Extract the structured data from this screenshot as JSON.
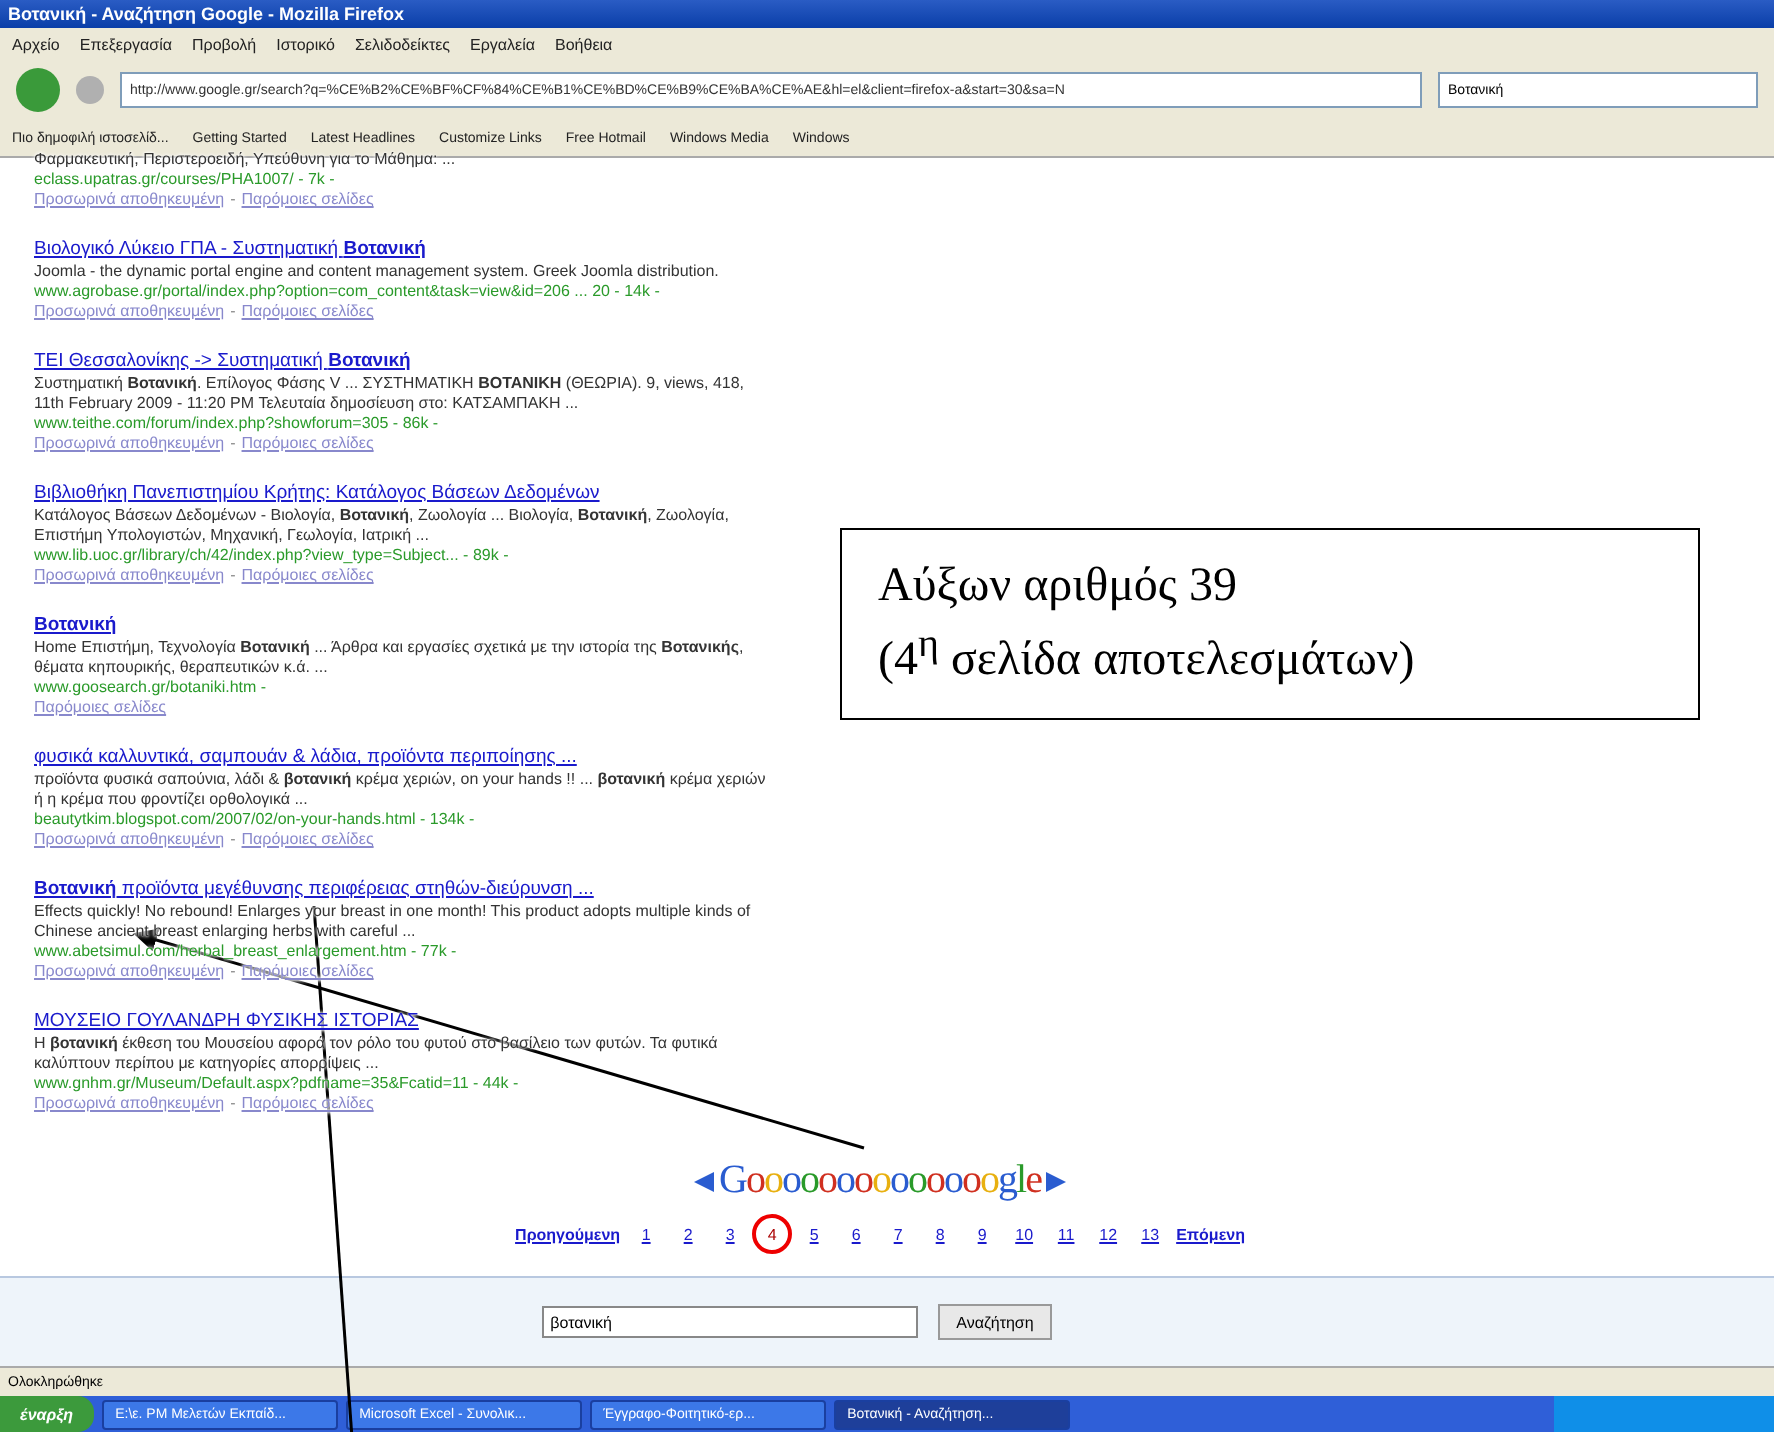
{
  "window": {
    "title": "Βοτανική - Αναζήτηση Google - Mozilla Firefox"
  },
  "menu": [
    "Αρχείο",
    "Επεξεργασία",
    "Προβολή",
    "Ιστορικό",
    "Σελιδοδείκτες",
    "Εργαλεία",
    "Βοήθεια"
  ],
  "address": "http://www.google.gr/search?q=%CE%B2%CE%BF%CF%84%CE%B1%CE%BD%CE%B9%CE%BA%CE%AE&hl=el&client=firefox-a&start=30&sa=N",
  "search_box": "Βοτανική",
  "bookmarks": [
    "Πιο δημοφιλή ιστοσελίδ...",
    "Getting Started",
    "Latest Headlines",
    "Customize Links",
    "Free Hotmail",
    "Windows Media",
    "Windows"
  ],
  "results": [
    {
      "snippet": "Φαρμακευτική, Περιστεροειδή, Υπεύθυνη για το Μάθημα: ...",
      "url": "eclass.upatras.gr/courses/PHA1007/ - 7k -",
      "links": [
        {
          "kind": "link",
          "text": "Προσωρινά αποθηκευμένη"
        },
        {
          "kind": "text",
          "text": "-"
        },
        {
          "kind": "link",
          "text": "Παρόμοιες σελίδες"
        }
      ]
    },
    {
      "title": "Βιολογικό Λύκειο ΓΠΑ - Συστηματική **Βοτανική**",
      "snippet": "Joomla - the dynamic portal engine and content management system. Greek Joomla distribution.",
      "url": "www.agrobase.gr/portal/index.php?option=com_content&task=view&id=206 ... 20 - 14k -",
      "links": [
        {
          "kind": "link",
          "text": "Προσωρινά αποθηκευμένη"
        },
        {
          "kind": "text",
          "text": "-"
        },
        {
          "kind": "link",
          "text": "Παρόμοιες σελίδες"
        }
      ]
    },
    {
      "title": "ΤΕΙ Θεσσαλονίκης -> Συστηματική **Βοτανική**",
      "snippet": "Συστηματική **Βοτανική**. Επίλογος Φάσης V ... ΣΥΣΤΗΜΑΤΙΚΗ **ΒΟΤΑΝΙΚΗ** (ΘΕΩΡΙΑ). 9, views, 418, 11th February 2009 - 11:20 PM Τελευταία δημοσίευση στο: ΚΑΤΣΑΜΠΑΚΗ ...",
      "url": "www.teithe.com/forum/index.php?showforum=305 - 86k -",
      "links": [
        {
          "kind": "link",
          "text": "Προσωρινά αποθηκευμένη"
        },
        {
          "kind": "text",
          "text": "-"
        },
        {
          "kind": "link",
          "text": "Παρόμοιες σελίδες"
        }
      ]
    },
    {
      "title": "Βιβλιοθήκη Πανεπιστημίου Κρήτης: Κατάλογος Βάσεων Δεδομένων",
      "snippet": "Κατάλογος Βάσεων Δεδομένων - Βιολογία, **Βοτανική**, Ζωολογία ... Βιολογία, **Βοτανική**, Ζωολογία, Επιστήμη Υπολογιστών, Μηχανική, Γεωλογία, Ιατρική ...",
      "url": "www.lib.uoc.gr/library/ch/42/index.php?view_type=Subject... - 89k -",
      "links": [
        {
          "kind": "link",
          "text": "Προσωρινά αποθηκευμένη"
        },
        {
          "kind": "text",
          "text": "-"
        },
        {
          "kind": "link",
          "text": "Παρόμοιες σελίδες"
        }
      ]
    },
    {
      "title": "**Βοτανική**",
      "snippet": "Home Επιστήμη, Τεχνολογία **Βοτανική** ... Άρθρα και εργασίες σχετικά με την ιστορία της **Βοτανικής**, θέματα κηπουρικής, θεραπευτικών κ.ά. ...",
      "url": "www.goosearch.gr/botaniki.htm -",
      "links": [
        {
          "kind": "link",
          "text": "Παρόμοιες σελίδες"
        }
      ]
    },
    {
      "title": "φυσικά καλλυντικά, σαμπουάν & λάδια, προϊόντα περιποίησης ...",
      "snippet": "προϊόντα φυσικά σαπούνια, λάδι & **βοτανική** κρέμα χεριών, on your hands !! ... **βοτανική** κρέμα χεριών ή η κρέμα που φροντίζει ορθολογικά ...",
      "url": "beautytkim.blogspot.com/2007/02/on-your-hands.html - 134k -",
      "links": [
        {
          "kind": "link",
          "text": "Προσωρινά αποθηκευμένη"
        },
        {
          "kind": "text",
          "text": "-"
        },
        {
          "kind": "link",
          "text": "Παρόμοιες σελίδες"
        }
      ]
    },
    {
      "title": "**Βοτανική** προϊόντα μεγέθυνσης περιφέρειας στηθών-διεύρυνση ...",
      "snippet": "Effects quickly! No rebound! Enlarges your breast in one month! This product adopts multiple kinds of Chinese ancient breast enlarging herbs with careful ...",
      "url": "www.abetsimul.com/herbal_breast_enlargement.htm - 77k -",
      "links": [
        {
          "kind": "link",
          "text": "Προσωρινά αποθηκευμένη"
        },
        {
          "kind": "text",
          "text": "-"
        },
        {
          "kind": "link",
          "text": "Παρόμοιες σελίδες"
        }
      ]
    },
    {
      "title": "ΜΟΥΣΕΙΟ ΓΟΥΛΑΝΔΡΗ ΦΥΣΙΚΗΣ ΙΣΤΟΡΙΑΣ",
      "snippet": "Η **βοτανική** έκθεση του Μουσείου αφορά τον ρόλο του φυτού στο βασίλειο των φυτών. Τα φυτικά καλύπτουν περίπου με κατηγορίες απορρίψεις ...",
      "url": "www.gnhm.gr/Museum/Default.aspx?pdfname=35&Fcatid=11 - 44k -",
      "links": [
        {
          "kind": "link",
          "text": "Προσωρινά αποθηκευμένη"
        },
        {
          "kind": "text",
          "text": "-"
        },
        {
          "kind": "link",
          "text": "Παρόμοιες σελίδες"
        }
      ]
    }
  ],
  "pagination": {
    "logo": "Goooooooooooooogle",
    "previous": "Προηγούμενη",
    "next": "Επόμενη",
    "pages": [
      {
        "label": "1",
        "selected": false
      },
      {
        "label": "2",
        "selected": false
      },
      {
        "label": "3",
        "selected": false
      },
      {
        "label": "4",
        "selected": true
      },
      {
        "label": "5",
        "selected": false
      },
      {
        "label": "6",
        "selected": false
      },
      {
        "label": "7",
        "selected": false
      },
      {
        "label": "8",
        "selected": false
      },
      {
        "label": "9",
        "selected": false
      },
      {
        "label": "10",
        "selected": false
      },
      {
        "label": "11",
        "selected": false
      },
      {
        "label": "12",
        "selected": false
      },
      {
        "label": "13",
        "selected": false
      }
    ]
  },
  "bottom_search": {
    "value": "βοτανική",
    "button": "Αναζήτηση"
  },
  "status_bar": "Ολοκληρώθηκε",
  "taskbar": {
    "start": "έναρξη",
    "tasks": [
      {
        "label": "E:\\ε. PM Μελετών Εκπαίδ...",
        "selected": false
      },
      {
        "label": "Microsoft Excel - Συνολικ...",
        "selected": false
      },
      {
        "label": "Έγγραφο-Φοιτητικό-ερ...",
        "selected": false
      },
      {
        "label": "Βοτανική - Αναζήτηση...",
        "selected": true
      }
    ]
  },
  "annotation": {
    "lines": [
      "Αύξων αριθμός 39",
      "(4$^{η}$ σελίδα αποτελεσμάτων)"
    ]
  }
}
